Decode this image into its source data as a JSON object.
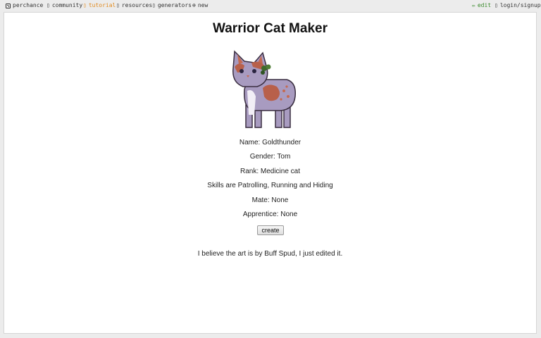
{
  "nav": {
    "perchance": "perchance",
    "community": "community",
    "tutorial": "tutorial",
    "resources": "resources",
    "generators": "generators",
    "new": "new",
    "edit": "edit",
    "login": "login/signup"
  },
  "icons": {
    "perchance": "dice-icon",
    "community": "chat-icon",
    "tutorial": "book-icon",
    "resources": "link-icon",
    "generators": "grid-icon",
    "new": "plus-circle-icon",
    "edit": "pencil-icon",
    "login": "user-icon"
  },
  "colors": {
    "tutorial": "#e08a1e",
    "edit": "#3a8a2c"
  },
  "page": {
    "title": "Warrior Cat Maker",
    "name": "Name: Goldthunder",
    "gender": "Gender: Tom",
    "rank": "Rank: Medicine cat",
    "skills": "Skills are Patrolling, Running and Hiding",
    "mate": "Mate: None",
    "apprentice": "Apprentice: None",
    "create_label": "create",
    "credit": "I believe the art is by Buff Spud, I just edited it."
  }
}
